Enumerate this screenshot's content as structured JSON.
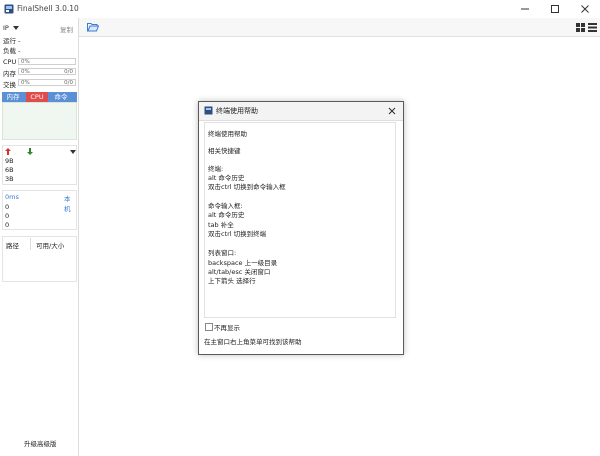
{
  "window": {
    "title": "FinalShell 3.0.10",
    "controls": [
      "minimize",
      "maximize",
      "close"
    ]
  },
  "sidebar": {
    "ip_label": "IP",
    "copy_label": "复制",
    "running_label": "运行 -",
    "load_label": "负载 -",
    "cpu": {
      "label": "CPU",
      "value": "0%"
    },
    "memory": {
      "label": "内存",
      "value": "0%",
      "detail": "0/0"
    },
    "swap": {
      "label": "交换",
      "value": "0%",
      "detail": "0/0"
    },
    "process_tabs": [
      "内存",
      "CPU",
      "命令"
    ],
    "network": {
      "ticks": [
        "9B",
        "6B",
        "3B"
      ]
    },
    "ping": {
      "value": "0ms",
      "host": "本机",
      "ticks": [
        "0",
        "0",
        "0"
      ]
    },
    "disk": {
      "path_header": "路径",
      "size_header": "可用/大小"
    },
    "upgrade_label": "升级高级版"
  },
  "toolbar": {
    "folder_icon": "folder-open-icon",
    "view_icons": [
      "grid-view-icon",
      "list-view-icon"
    ]
  },
  "dialog": {
    "title": "终端使用帮助",
    "lines": [
      "终端使用帮助",
      "",
      "相关快捷键",
      "",
      "终端:",
      "alt 命令历史",
      "双击ctrl 切换到命令输入框",
      "",
      "命令输入框:",
      "alt 命令历史",
      "tab 补全",
      "双击ctrl 切换到终端",
      "",
      "列表窗口:",
      "backspace 上一级目录",
      "alt/tab/esc 关闭窗口",
      "上下箭头 选择行"
    ],
    "checkbox_label": "不再显示",
    "footer_note": "在主窗口右上角菜单可找到该帮助"
  },
  "colors": {
    "accent": "#5b8fd6",
    "cpu_tab": "#e04b4b",
    "upload_arrow": "#d9302c",
    "download_arrow": "#2a8a2a"
  }
}
